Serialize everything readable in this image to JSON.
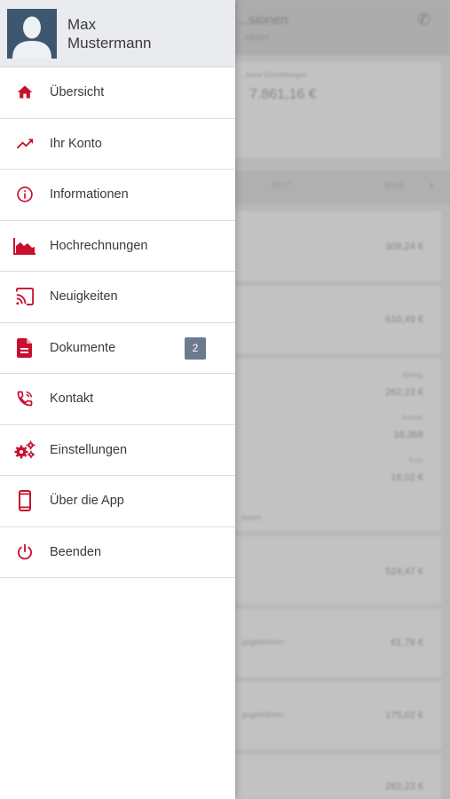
{
  "user": {
    "name_line1": "Max",
    "name_line2": "Mustermann"
  },
  "menu": {
    "items": [
      {
        "label": "Übersicht",
        "icon": "home-icon"
      },
      {
        "label": "Ihr Konto",
        "icon": "trending-up-icon"
      },
      {
        "label": "Informationen",
        "icon": "info-icon"
      },
      {
        "label": "Hochrechnungen",
        "icon": "area-chart-icon"
      },
      {
        "label": "Neuigkeiten",
        "icon": "cast-icon"
      },
      {
        "label": "Dokumente",
        "icon": "document-icon",
        "badge": "2"
      },
      {
        "label": "Kontakt",
        "icon": "phone-icon"
      },
      {
        "label": "Einstellungen",
        "icon": "gears-icon"
      },
      {
        "label": "Über die App",
        "icon": "smartphone-icon"
      },
      {
        "label": "Beenden",
        "icon": "power-icon"
      }
    ]
  },
  "colors": {
    "accent": "#c8102e",
    "badge": "#6b7a8f",
    "header_bg": "#e9ebee"
  },
  "background": {
    "title": "...sionen",
    "subtitle": "...eksen",
    "card_label": "...ttene Einzahlungen",
    "card_value": "7.861,16 €",
    "tab1": "2017",
    "tab2": "2016",
    "rows": [
      {
        "amount": "309,24 €"
      },
      {
        "amount": "610,49 €"
      },
      {
        "label_a": "Betrag",
        "amount_a": "262,23 €",
        "label_b": "Anteile",
        "amount_b": "16,368",
        "label_c": "Kurs",
        "amount_c": "16,02 €",
        "left": "...ionen"
      },
      {
        "amount": "524,47 €"
      },
      {
        "left": "...gsgebühren",
        "amount": "61,78 €"
      },
      {
        "left": "...gsgebühren",
        "amount": "175,02 €"
      },
      {
        "amount": "262,23 €"
      }
    ]
  }
}
